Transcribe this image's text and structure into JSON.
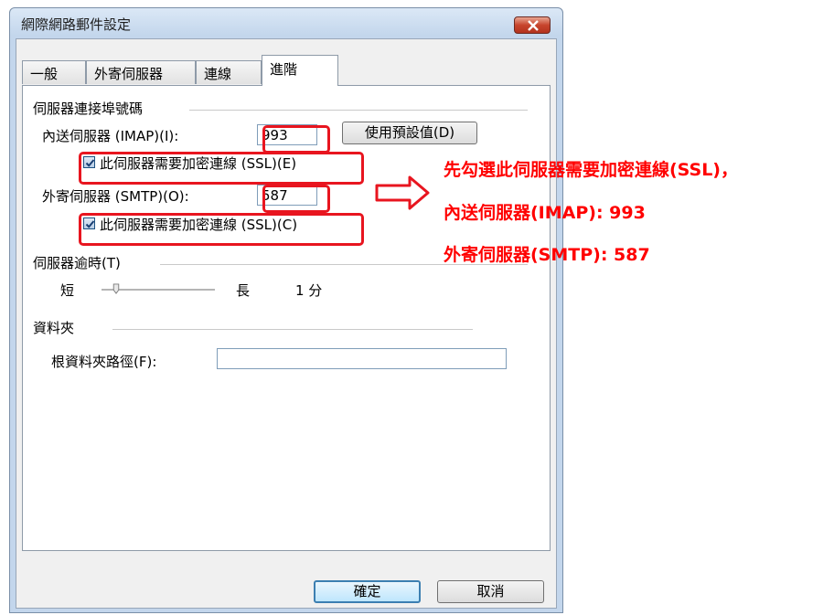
{
  "window": {
    "title": "網際網路郵件設定"
  },
  "tabs": [
    {
      "label": "一般",
      "active": false
    },
    {
      "label": "外寄伺服器",
      "active": false
    },
    {
      "label": "連線",
      "active": false
    },
    {
      "label": "進階",
      "active": true
    }
  ],
  "ports": {
    "group_label": "伺服器連接埠號碼",
    "incoming_label": "內送伺服器 (IMAP)(I):",
    "incoming_value": "993",
    "use_defaults_label": "使用預設值(D)",
    "incoming_ssl_label": "此伺服器需要加密連線 (SSL)(E)",
    "incoming_ssl_checked": true,
    "outgoing_label": "外寄伺服器 (SMTP)(O):",
    "outgoing_value": "587",
    "outgoing_ssl_label": "此伺服器需要加密連線 (SSL)(C)",
    "outgoing_ssl_checked": true
  },
  "timeout": {
    "group_label": "伺服器逾時(T)",
    "short_label": "短",
    "long_label": "長",
    "value_label": "1 分",
    "slider_fraction": 0.0
  },
  "folders": {
    "group_label": "資料夾",
    "root_label": "根資料夾路徑(F):",
    "root_value": ""
  },
  "footer": {
    "ok_label": "確定",
    "cancel_label": "取消"
  },
  "annotations": {
    "line1": "先勾選此伺服器需要加密連線(SSL)，",
    "line2": "內送伺服器(IMAP): 993",
    "line3": "外寄伺服器(SMTP): 587"
  },
  "colors": {
    "annotation": "#ff0000",
    "highlight_box": "#e8151f",
    "close_button": "#c7452d"
  }
}
